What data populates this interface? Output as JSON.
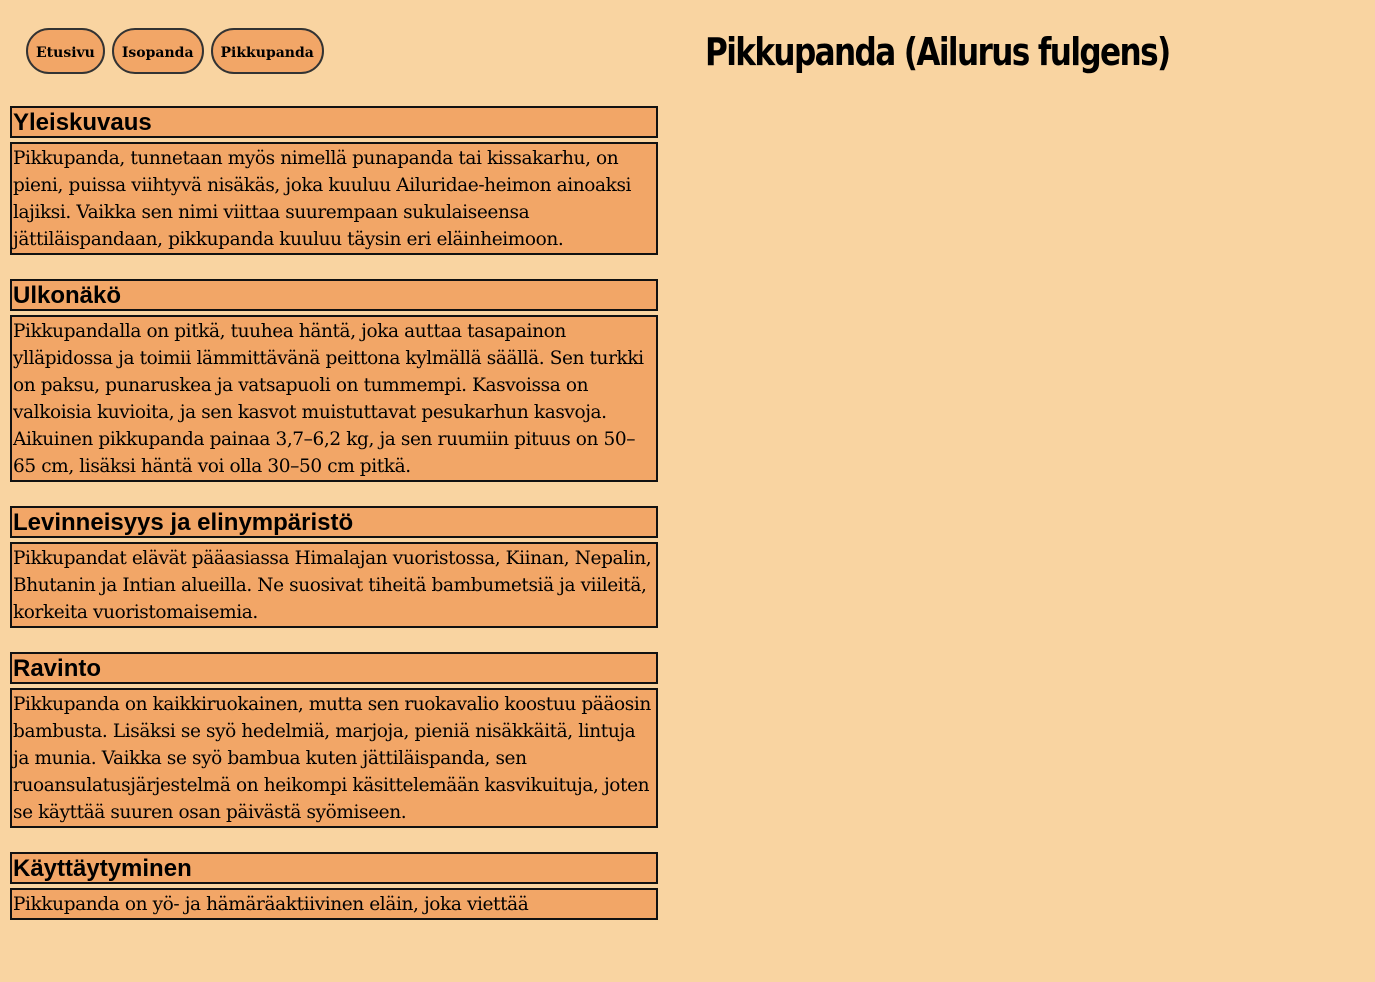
{
  "nav": {
    "items": [
      {
        "label": "Etusivu"
      },
      {
        "label": "Isopanda"
      },
      {
        "label": "Pikkupanda"
      }
    ]
  },
  "page_title": "Pikkupanda (Ailurus fulgens)",
  "sections": [
    {
      "heading": "Yleiskuvaus",
      "text": "Pikkupanda, tunnetaan myös nimellä punapanda tai kissakarhu, on pieni, puissa viihtyvä nisäkäs, joka kuuluu Ailuridae-heimon ainoaksi lajiksi. Vaikka sen nimi viittaa suurempaan sukulaiseensa jättiläispandaan, pikkupanda kuuluu täysin eri eläinheimoon."
    },
    {
      "heading": "Ulkonäkö",
      "text": "Pikkupandalla on pitkä, tuuhea häntä, joka auttaa tasapainon ylläpidossa ja toimii lämmittävänä peittona kylmällä säällä. Sen turkki on paksu, punaruskea ja vatsapuoli on tummempi. Kasvoissa on valkoisia kuvioita, ja sen kasvot muistuttavat pesukarhun kasvoja. Aikuinen pikkupanda painaa 3,7–6,2 kg, ja sen ruumiin pituus on 50–65 cm, lisäksi häntä voi olla 30–50 cm pitkä."
    },
    {
      "heading": "Levinneisyys ja elinympäristö",
      "text": "Pikkupandat elävät pääasiassa Himalajan vuoristossa, Kiinan, Nepalin, Bhutanin ja Intian alueilla. Ne suosivat tiheitä bambumetsiä ja viileitä, korkeita vuoristomaisemia."
    },
    {
      "heading": "Ravinto",
      "text": "Pikkupanda on kaikkiruokainen, mutta sen ruokavalio koostuu pääosin bambusta. Lisäksi se syö hedelmiä, marjoja, pieniä nisäkkäitä, lintuja ja munia. Vaikka se syö bambua kuten jättiläispanda, sen ruoansulatusjärjestelmä on heikompi käsittelemään kasvikuituja, joten se käyttää suuren osan päivästä syömiseen."
    },
    {
      "heading": "Käyttäytyminen",
      "text": "Pikkupanda on yö- ja hämäräaktiivinen eläin, joka viettää"
    }
  ],
  "colors": {
    "page_background": "#f9d4a1",
    "box_background": "#f2a667",
    "border": "#111111"
  }
}
